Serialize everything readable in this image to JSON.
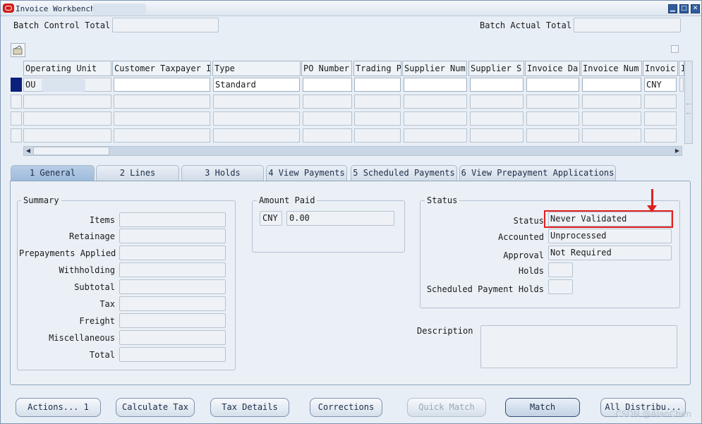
{
  "window": {
    "title": "Invoice Workbench"
  },
  "batch": {
    "control_total_label": "Batch Control Total",
    "actual_total_label": "Batch Actual Total"
  },
  "grid": {
    "headers": [
      "Operating Unit",
      "Customer Taxpayer I",
      "Type",
      "PO Number",
      "Trading P",
      "Supplier Num",
      "Supplier S",
      "Invoice Da",
      "Invoice Num",
      "Invoic",
      "I"
    ],
    "row1": {
      "operating_unit": "OU",
      "type": "Standard",
      "currency": "CNY"
    }
  },
  "tabs": [
    "1 General",
    "2 Lines",
    "3 Holds",
    "4 View Payments",
    "5 Scheduled Payments",
    "6 View Prepayment Applications"
  ],
  "summary": {
    "title": "Summary",
    "labels": [
      "Items",
      "Retainage",
      "Prepayments Applied",
      "Withholding",
      "Subtotal",
      "Tax",
      "Freight",
      "Miscellaneous",
      "Total"
    ]
  },
  "amount_paid": {
    "title": "Amount Paid",
    "currency": "CNY",
    "value": "0.00"
  },
  "status_group": {
    "title": "Status",
    "status_label": "Status",
    "status_value": "Never Validated",
    "accounted_label": "Accounted",
    "accounted_value": "Unprocessed",
    "approval_label": "Approval",
    "approval_value": "Not Required",
    "holds_label": "Holds",
    "scheduled_holds_label": "Scheduled Payment Holds"
  },
  "description_label": "Description",
  "buttons": {
    "actions": "Actions... 1",
    "calculate_tax": "Calculate Tax",
    "tax_details": "Tax Details",
    "corrections": "Corrections",
    "quick_match": "Quick Match",
    "match": "Match",
    "all_distributions": "All Distribu..."
  },
  "watermark": "CSDN @AlanChen",
  "colors": {
    "highlight": "#e02020",
    "active_tab": "#9dbbdc"
  }
}
